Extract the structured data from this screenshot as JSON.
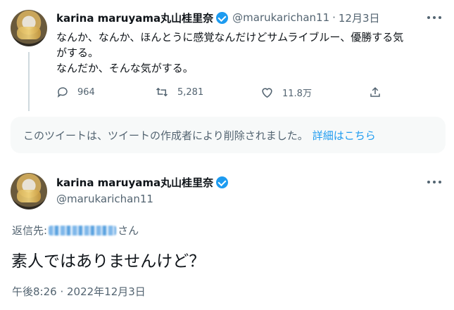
{
  "tweet1": {
    "display_name": "karina maruyama丸山桂里奈",
    "handle": "@marukarichan11",
    "separator": "·",
    "date": "12月3日",
    "body_lines": [
      "なんか、なんか、ほんとうに感覚なんだけどサムライブルー、優勝する気",
      "がする。",
      "なんだか、そんな気がする。"
    ],
    "replies": "964",
    "retweets": "5,281",
    "likes": "11.8万"
  },
  "deleted_notice": {
    "text": "このツイートは、ツイートの作成者により削除されました。",
    "link": "詳細はこちら"
  },
  "tweet2": {
    "display_name": "karina maruyama丸山桂里奈",
    "handle": "@marukarichan11",
    "reply_to_label": "返信先:",
    "reply_to_suffix": "さん",
    "body": "素人ではありませんけど？",
    "timestamp": "午後8:26 · 2022年12月3日"
  },
  "colors": {
    "accent": "#1d9bf0",
    "text_primary": "#0f1419",
    "text_secondary": "#536471",
    "deleted_bg": "#f7f9f9"
  },
  "icons": [
    "verified-badge-icon",
    "more-icon",
    "reply-icon",
    "retweet-icon",
    "like-icon",
    "share-icon"
  ]
}
